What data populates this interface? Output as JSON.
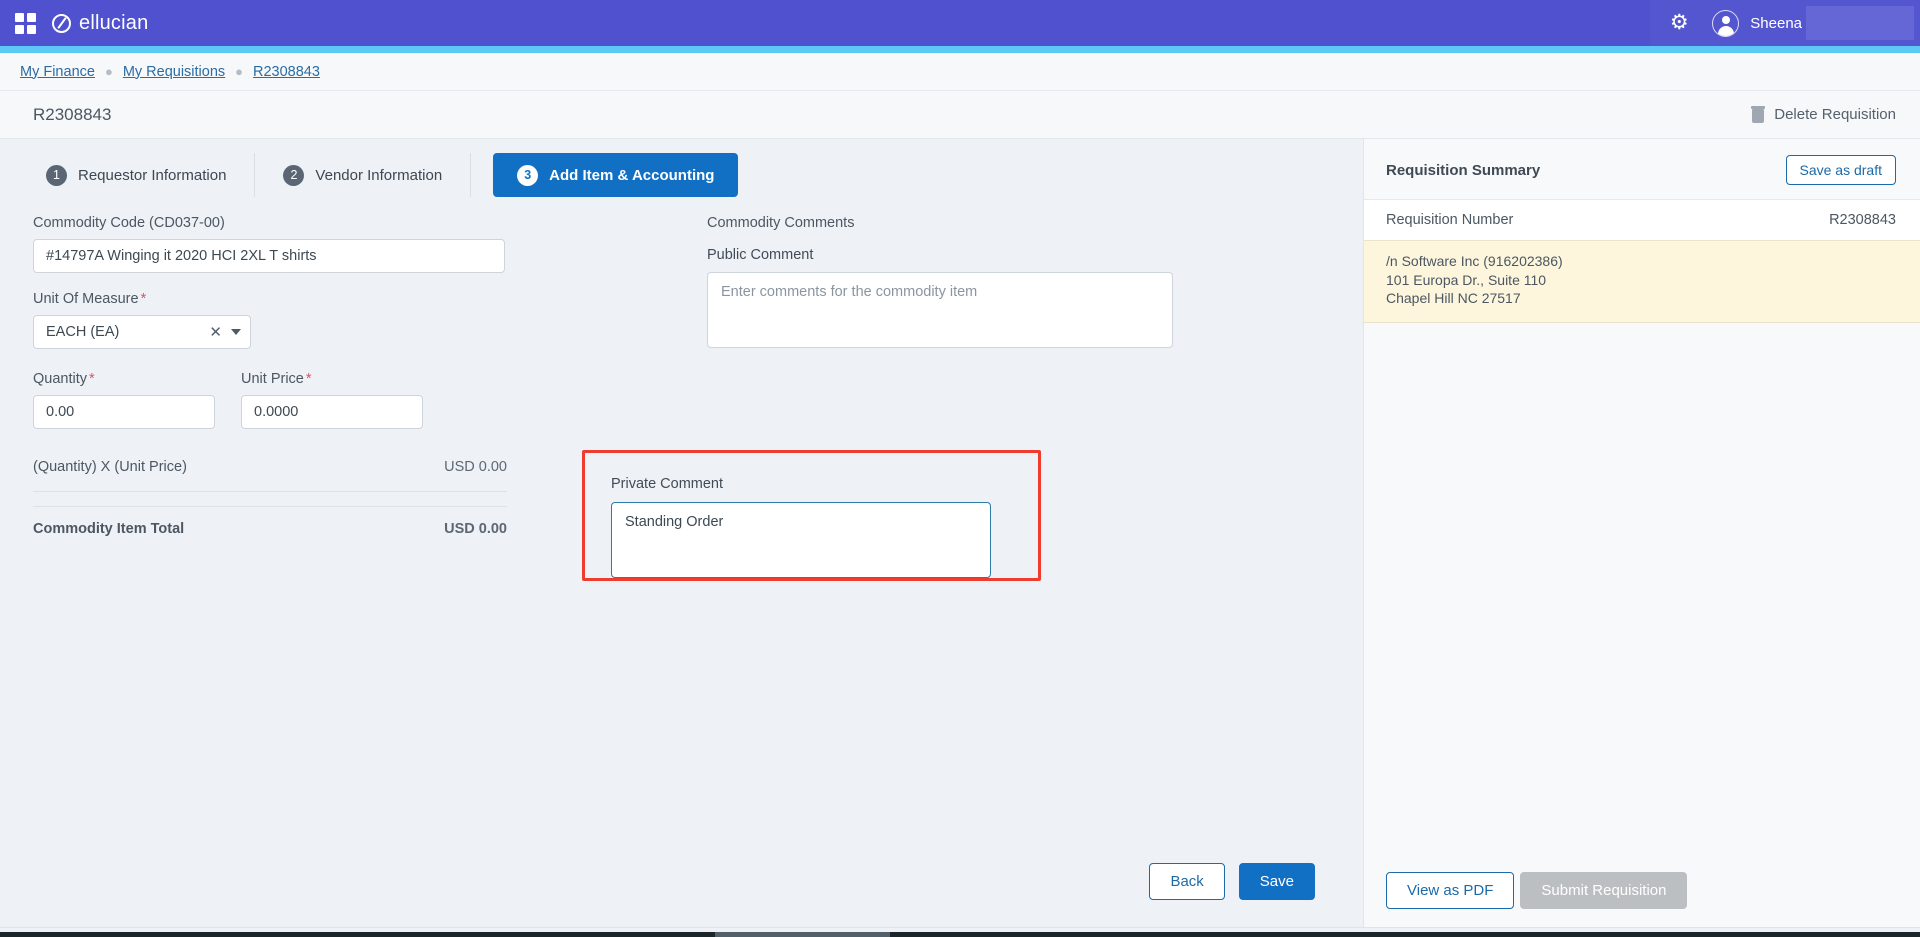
{
  "topbar": {
    "grid_icon": "apps-grid-icon",
    "brand": "ellucian",
    "brand_icon": "ellucian-logo-icon",
    "gear_icon": "gear-icon",
    "gear_glyph": "⚙",
    "avatar_icon": "user-avatar-icon",
    "user_name": "Sheena"
  },
  "breadcrumb": {
    "items": [
      {
        "label": "My Finance"
      },
      {
        "label": "My Requisitions"
      },
      {
        "label": "R2308843"
      }
    ],
    "separator": "●"
  },
  "page": {
    "title": "R2308843",
    "delete_label": "Delete Requisition",
    "delete_icon": "trash-icon"
  },
  "steps": [
    {
      "num": "1",
      "label": "Requestor Information",
      "active": false
    },
    {
      "num": "2",
      "label": "Vendor Information",
      "active": false
    },
    {
      "num": "3",
      "label": "Add Item & Accounting",
      "active": true
    }
  ],
  "form": {
    "commodity_code_label": "Commodity Code (CD037-00)",
    "commodity_code_value": "#14797A Winging it 2020 HCI 2XL T shirts",
    "uom_label": "Unit Of Measure",
    "uom_value": "EACH (EA)",
    "uom_clear_icon": "clear-x-icon",
    "uom_caret_icon": "chevron-down-icon",
    "quantity_label": "Quantity",
    "quantity_value": "0.00",
    "unit_price_label": "Unit Price",
    "unit_price_value": "0.0000",
    "required_star": "*",
    "calc_label": "(Quantity) X (Unit Price)",
    "calc_amount": "USD 0.00",
    "item_total_label": "Commodity Item Total",
    "item_total_amount": "USD 0.00"
  },
  "comments": {
    "section_label": "Commodity Comments",
    "public_label": "Public Comment",
    "public_placeholder": "Enter comments for the commodity item",
    "public_value": "",
    "private_label": "Private Comment",
    "private_value": "Standing Order",
    "highlight_color": "#f03c2e"
  },
  "summary": {
    "title": "Requisition Summary",
    "save_draft_label": "Save as draft",
    "req_number_label": "Requisition Number",
    "req_number_value": "R2308843",
    "vendor_line1": "/n Software Inc (916202386)",
    "vendor_line2": "101 Europa Dr., Suite 110",
    "vendor_line3": "Chapel Hill NC 27517"
  },
  "footer": {
    "back_label": "Back",
    "save_label": "Save",
    "view_pdf_label": "View as PDF",
    "submit_label": "Submit Requisition"
  },
  "colors": {
    "brand_purple": "#4f51ce",
    "accent_cyan": "#5bc8f5",
    "primary_blue": "#1170c4",
    "link_blue": "#2c6ca3",
    "vendor_yellow": "#fdf6dc"
  }
}
